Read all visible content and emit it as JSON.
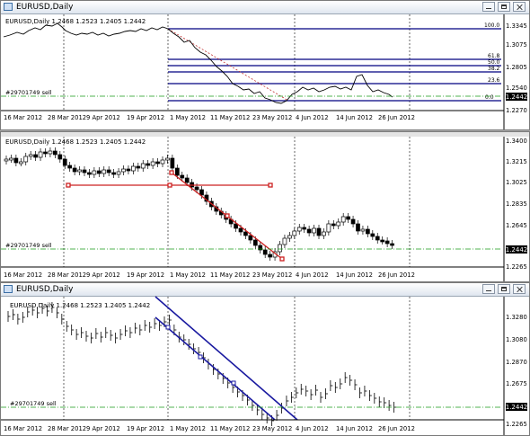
{
  "windows": [
    {
      "title": "EURUSD,Daily",
      "symbol_line": "EURUSD,Daily  1.2468 1.2523 1.2405 1.2442",
      "order_label": "#29701749 sell",
      "current_price": "1.2442",
      "y_ticks": [
        "1.3345",
        "1.3075",
        "1.2805",
        "1.2540",
        "1.2270"
      ],
      "x_ticks": [
        "16 Mar 2012",
        "28 Mar 2012",
        "9 Apr 2012",
        "19 Apr 2012",
        "1 May 2012",
        "11 May 2012",
        "23 May 2012",
        "4 Jun 2012",
        "14 Jun 2012",
        "26 Jun 2012"
      ],
      "fib_levels": [
        "100.0",
        "61.8",
        "50.0",
        "38.2",
        "23.6",
        "0.0"
      ],
      "indicator": "fibonacci-retracement",
      "line_color": "#1a1a80",
      "fib_color": "#000080"
    },
    {
      "title": "",
      "symbol_line": "EURUSD,Daily  1.2468 1.2523 1.2405 1.2442",
      "order_label": "#29701749 sell",
      "current_price": "1.2442",
      "y_ticks": [
        "1.3400",
        "1.3215",
        "1.3025",
        "1.2835",
        "1.2645",
        "1.2455",
        "1.2265"
      ],
      "x_ticks": [
        "16 Mar 2012",
        "28 Mar 2012",
        "9 Apr 2012",
        "19 Apr 2012",
        "1 May 2012",
        "11 May 2012",
        "23 May 2012",
        "4 Jun 2012",
        "14 Jun 2012",
        "26 Jun 2012"
      ],
      "indicator": "trendlines",
      "trend_color": "#cc2020"
    },
    {
      "title": "EURUSD,Daily",
      "symbol_line": "EURUSD,Daily  1.2468 1.2523 1.2405 1.2442",
      "order_label": "#29701749 sell",
      "current_price": "1.2442",
      "y_ticks": [
        "1.3280",
        "1.3080",
        "1.2870",
        "1.2675",
        "1.2470",
        "1.2265"
      ],
      "x_ticks": [
        "16 Mar 2012",
        "28 Mar 2012",
        "9 Apr 2012",
        "19 Apr 2012",
        "1 May 2012",
        "11 May 2012",
        "23 May 2012",
        "4 Jun 2012",
        "14 Jun 2012",
        "26 Jun 2012"
      ],
      "indicator": "equidistant-channel",
      "channel_color": "#1a1aa0"
    }
  ]
}
